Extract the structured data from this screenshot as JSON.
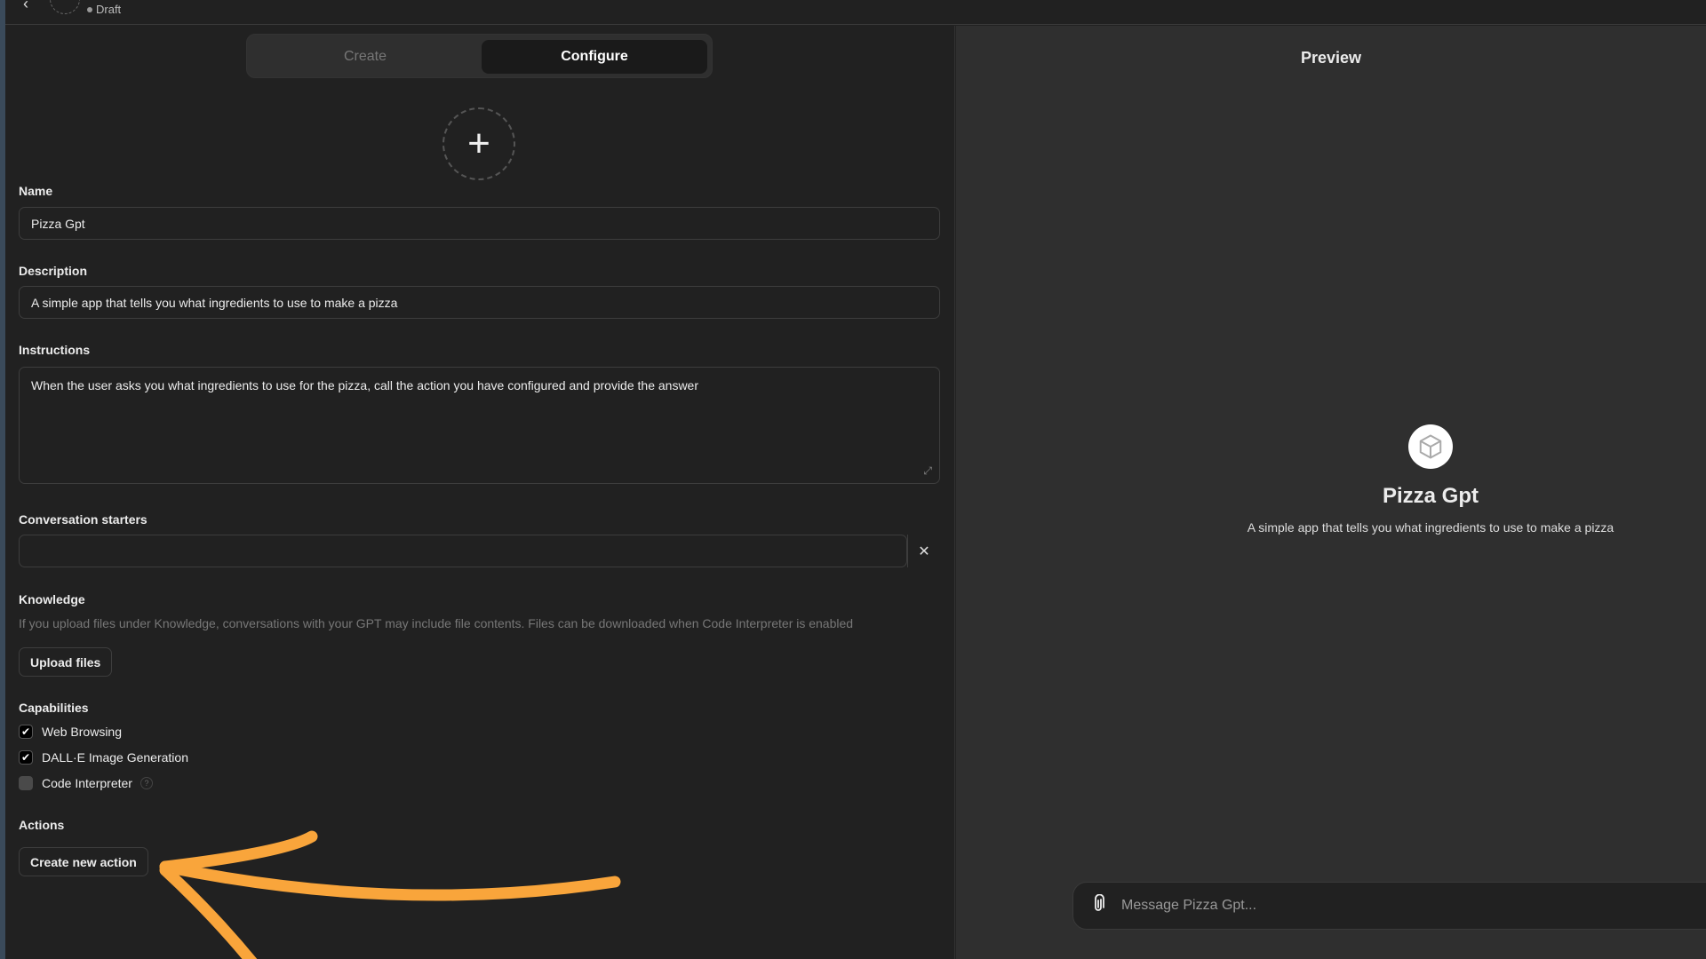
{
  "header": {
    "status": "Draft"
  },
  "tabs": [
    {
      "label": "Create",
      "active": false
    },
    {
      "label": "Configure",
      "active": true
    }
  ],
  "form": {
    "name_label": "Name",
    "name_value": "Pizza Gpt",
    "description_label": "Description",
    "description_value": "A simple app that tells you what ingredients to use to make a pizza",
    "instructions_label": "Instructions",
    "instructions_value": "When the user asks you what ingredients to use for the pizza, call the action you have configured and provide the answer",
    "starters_label": "Conversation starters",
    "starters_value": "",
    "knowledge_label": "Knowledge",
    "knowledge_note": "If you upload files under Knowledge, conversations with your GPT may include file contents. Files can be downloaded when Code Interpreter is enabled",
    "upload_label": "Upload files",
    "capabilities_label": "Capabilities",
    "capabilities": [
      {
        "label": "Web Browsing",
        "checked": true
      },
      {
        "label": "DALL·E Image Generation",
        "checked": true
      },
      {
        "label": "Code Interpreter",
        "checked": false
      }
    ],
    "actions_label": "Actions",
    "create_action_label": "Create new action"
  },
  "preview": {
    "title": "Preview",
    "gpt_name": "Pizza Gpt",
    "gpt_description": "A simple app that tells you what ingredients to use to make a pizza",
    "message_placeholder": "Message Pizza Gpt..."
  },
  "colors": {
    "annotation_arrow": "#f9a53b",
    "left_bg": "#212121",
    "right_bg": "#2f2f2f"
  }
}
